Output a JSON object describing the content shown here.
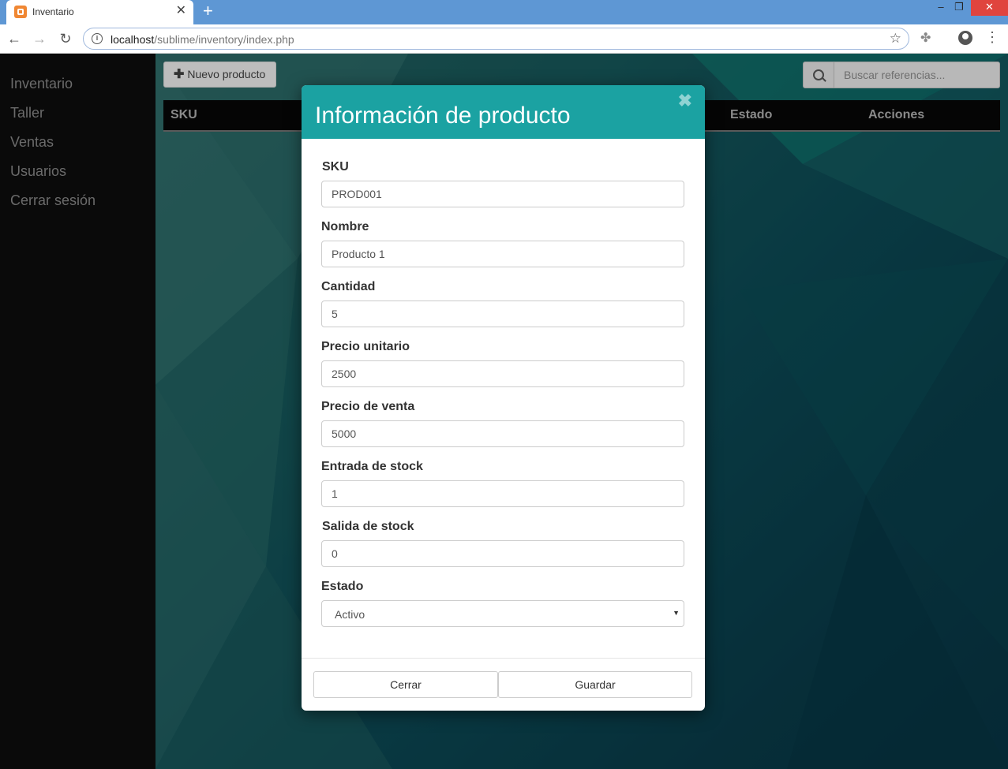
{
  "browser": {
    "tab_title": "Inventario",
    "url_host": "localhost",
    "url_path": "/sublime/inventory/index.php"
  },
  "sidebar": {
    "items": [
      {
        "label": "Inventario"
      },
      {
        "label": "Taller"
      },
      {
        "label": "Ventas"
      },
      {
        "label": "Usuarios"
      },
      {
        "label": "Cerrar sesión"
      }
    ]
  },
  "toolbar": {
    "new_product_label": "Nuevo producto",
    "search_placeholder": "Buscar referencias..."
  },
  "table": {
    "columns": [
      "SKU",
      "Estado",
      "Acciones"
    ]
  },
  "modal": {
    "title": "Información de producto",
    "fields": [
      {
        "label": "SKU",
        "value": "PROD001"
      },
      {
        "label": "Nombre",
        "value": "Producto 1"
      },
      {
        "label": "Cantidad",
        "value": "5"
      },
      {
        "label": "Precio unitario",
        "value": "2500"
      },
      {
        "label": "Precio de venta",
        "value": "5000"
      },
      {
        "label": "Entrada de stock",
        "value": "1"
      },
      {
        "label": "Salida de stock",
        "value": "0"
      }
    ],
    "status": {
      "label": "Estado",
      "selected": "Activo"
    },
    "close_label": "Cerrar",
    "save_label": "Guardar"
  },
  "colors": {
    "modal_header": "#1ba2a2",
    "sidebar_bg": "#0a0a0a",
    "content_bg": "#0e5866"
  }
}
